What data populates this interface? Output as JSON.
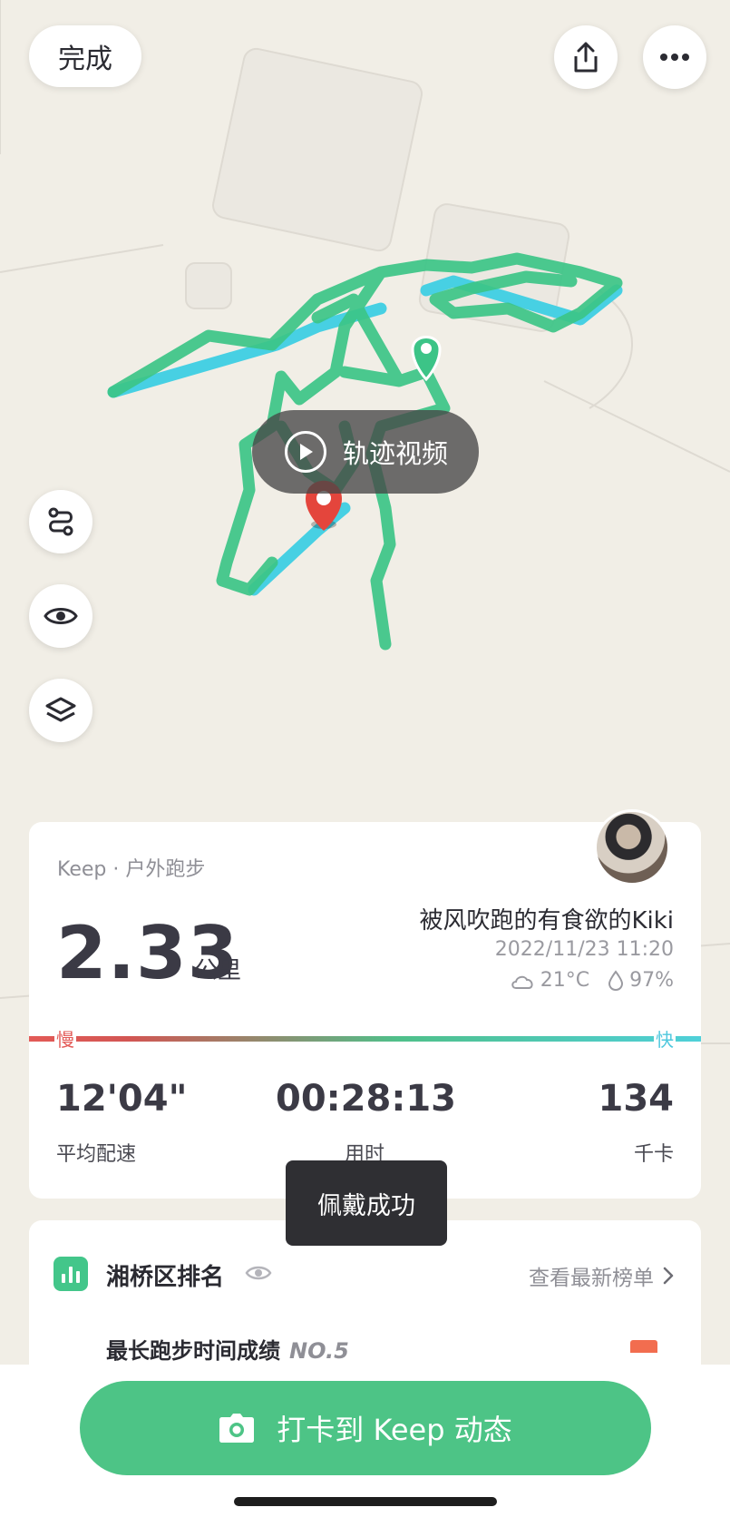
{
  "header": {
    "done_label": "完成",
    "share_icon": "share-icon",
    "more_icon": "more-icon"
  },
  "map": {
    "track_video_label": "轨迹视频",
    "side_tools": [
      "route-icon",
      "eye-icon",
      "layers-icon"
    ],
    "route_colors": {
      "main": "#3cc487",
      "fast": "#47d0e3",
      "marker": "#e4453c"
    }
  },
  "summary": {
    "source": "Keep · 户外跑步",
    "distance": "2.33",
    "distance_unit": "公里",
    "username": "被风吹跑的有食欲的Kiki",
    "datetime": "2022/11/23 11:20",
    "temperature": "21°C",
    "humidity": "97%",
    "pace_slow_label": "慢",
    "pace_fast_label": "快",
    "stats": [
      {
        "value": "12'04\"",
        "label": "平均配速"
      },
      {
        "value": "00:28:13",
        "label": "用时"
      },
      {
        "value": "134",
        "label": "千卡"
      }
    ]
  },
  "toast": "佩戴成功",
  "ranking": {
    "title": "湘桥区排名",
    "link": "查看最新榜单",
    "record_label": "最长跑步时间成绩",
    "record_rank": "NO.5"
  },
  "bottom": {
    "checkin_label": "打卡到 Keep 动态"
  }
}
